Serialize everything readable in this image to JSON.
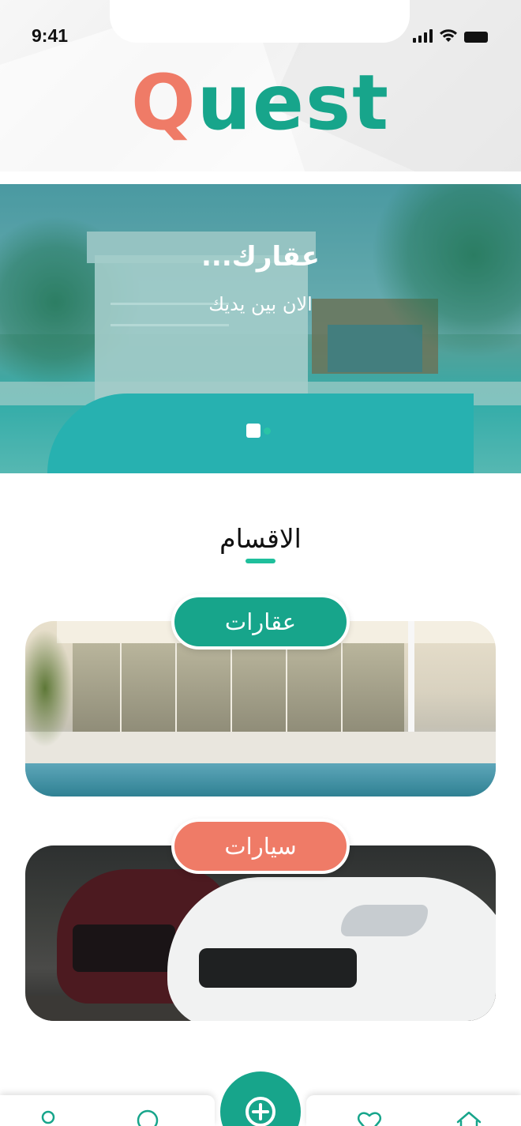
{
  "status_bar": {
    "time": "9:41"
  },
  "brand": {
    "logo_first": "Q",
    "logo_rest": "uest",
    "primary_color": "#17a58b",
    "accent_color": "#ef7b67"
  },
  "hero": {
    "title": "عقارك...",
    "subtitle": "الان بين يديك",
    "slides_count": 2,
    "active_slide": 1
  },
  "categories": {
    "title": "الاقسام",
    "items": [
      {
        "label": "عقارات",
        "color": "#17a58b"
      },
      {
        "label": "سيارات",
        "color": "#ef7b67"
      }
    ]
  },
  "bottom_nav": {
    "items": [
      {
        "icon": "profile-icon"
      },
      {
        "icon": "search-icon"
      },
      {
        "icon": "add-circle-icon"
      },
      {
        "icon": "heart-icon"
      },
      {
        "icon": "home-icon"
      }
    ]
  }
}
